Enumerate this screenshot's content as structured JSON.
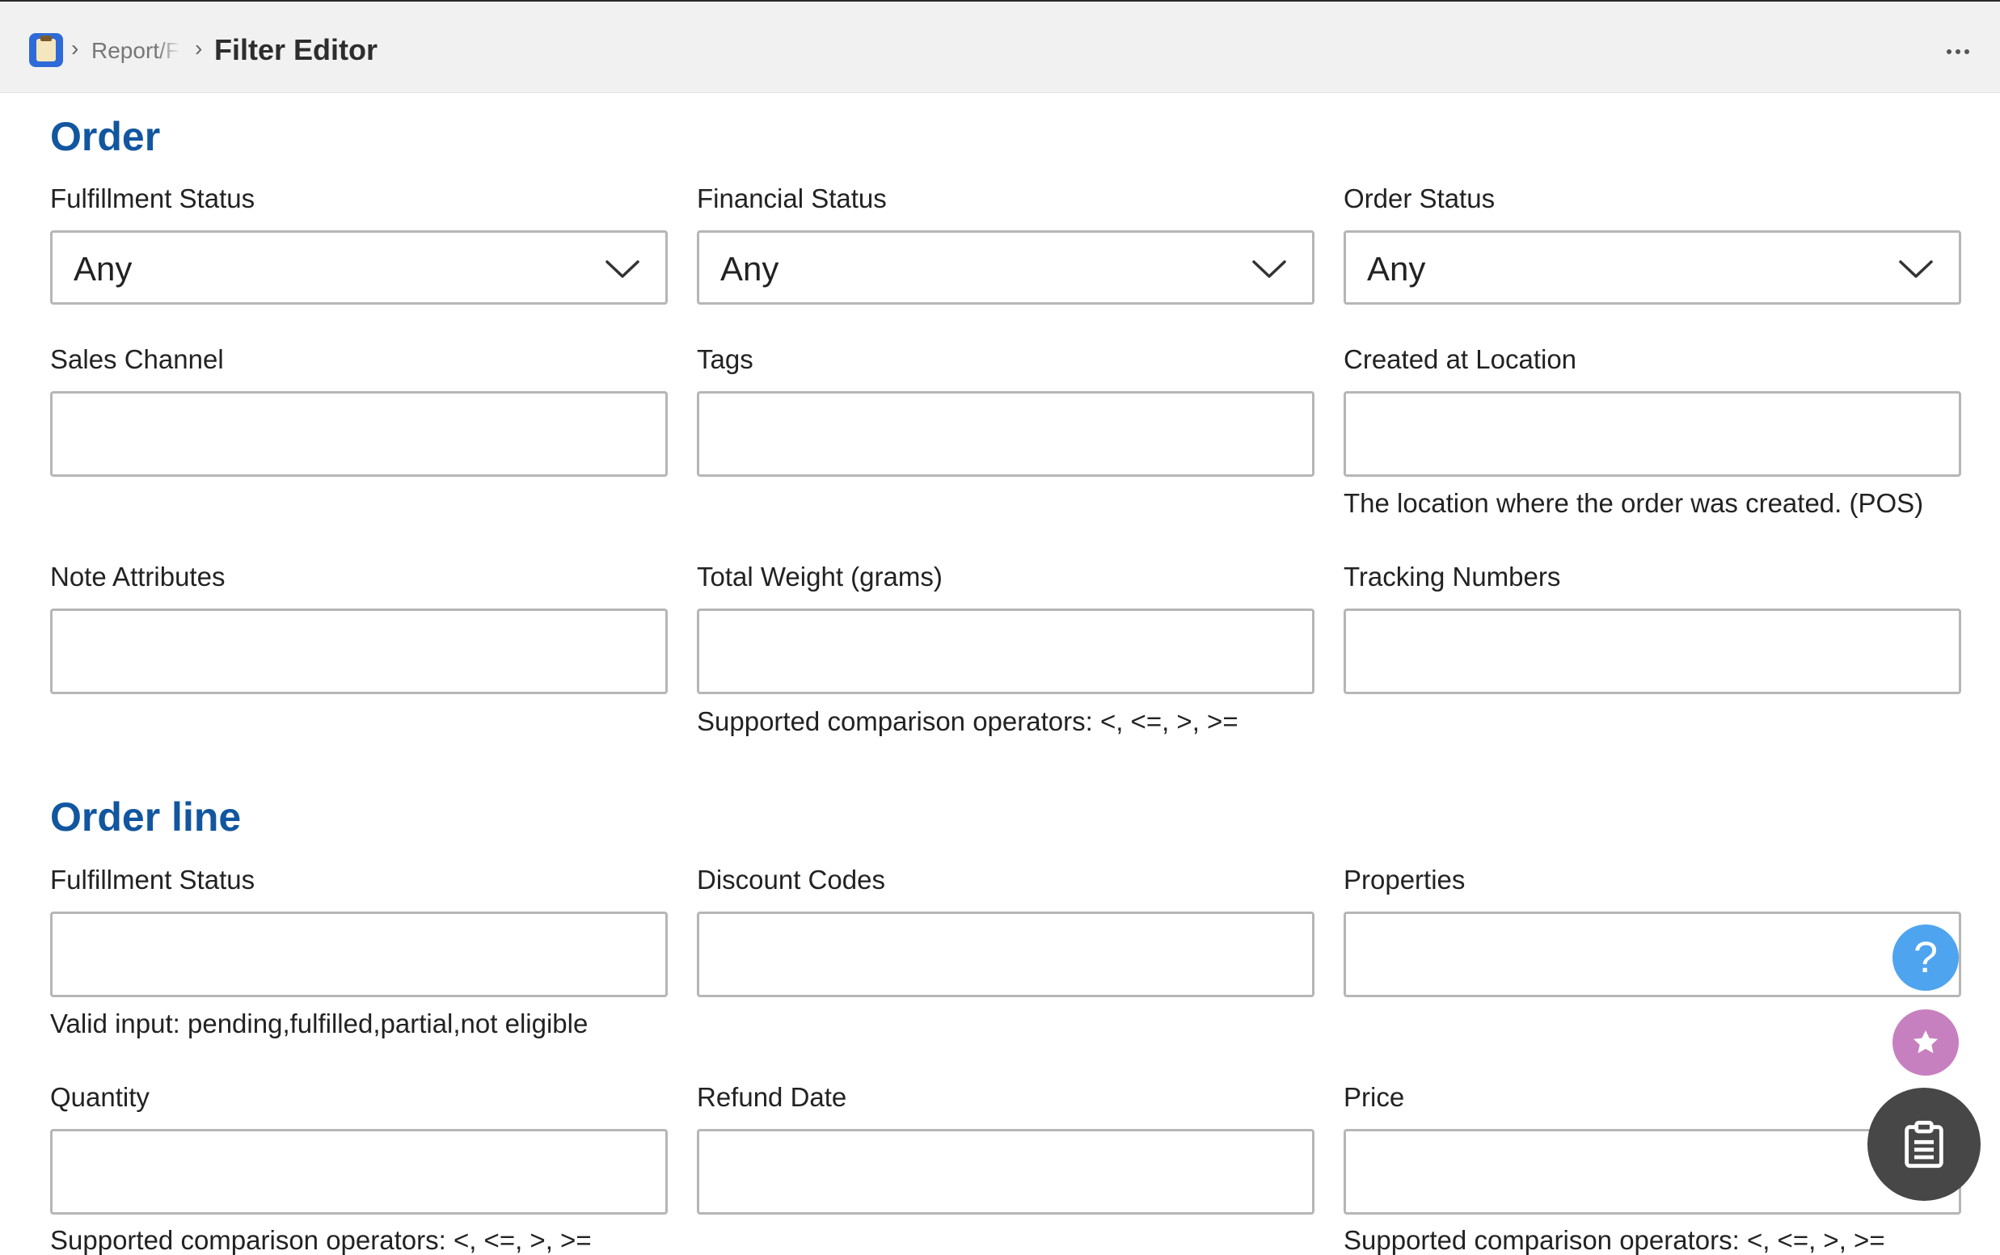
{
  "header": {
    "app_icon": "notepad-icon",
    "breadcrumb_parent": "Report/F",
    "title": "Filter Editor",
    "more_icon": "more-horizontal-icon"
  },
  "order": {
    "title": "Order",
    "fulfillment_status": {
      "label": "Fulfillment Status",
      "value": "Any"
    },
    "financial_status": {
      "label": "Financial Status",
      "value": "Any"
    },
    "order_status": {
      "label": "Order Status",
      "value": "Any"
    },
    "sales_channel": {
      "label": "Sales Channel",
      "value": ""
    },
    "tags": {
      "label": "Tags",
      "value": ""
    },
    "created_at_location": {
      "label": "Created at Location",
      "value": "",
      "help": "The location where the order was created. (POS)"
    },
    "note_attributes": {
      "label": "Note Attributes",
      "value": ""
    },
    "total_weight": {
      "label": "Total Weight (grams)",
      "value": "",
      "help": "Supported comparison operators: <, <=, >, >="
    },
    "tracking_numbers": {
      "label": "Tracking Numbers",
      "value": ""
    }
  },
  "order_line": {
    "title": "Order line",
    "fulfillment_status": {
      "label": "Fulfillment Status",
      "value": "",
      "help": "Valid input: pending,fulfilled,partial,not eligible"
    },
    "discount_codes": {
      "label": "Discount Codes",
      "value": ""
    },
    "properties": {
      "label": "Properties",
      "value": ""
    },
    "quantity": {
      "label": "Quantity",
      "value": "",
      "help": "Supported comparison operators: <, <=, >, >="
    },
    "refund_date": {
      "label": "Refund Date",
      "value": ""
    },
    "price": {
      "label": "Price",
      "value": "",
      "help": "Supported comparison operators: <, <=, >, >="
    }
  },
  "floating_buttons": {
    "help_glyph": "?",
    "colors": {
      "help": "#4ea4ef",
      "favorite": "#c780bf",
      "clipboard": "#474747"
    }
  },
  "colors": {
    "section_title": "#11569f",
    "border": "#b6b6b6",
    "header_bg": "#f1f1f1"
  }
}
